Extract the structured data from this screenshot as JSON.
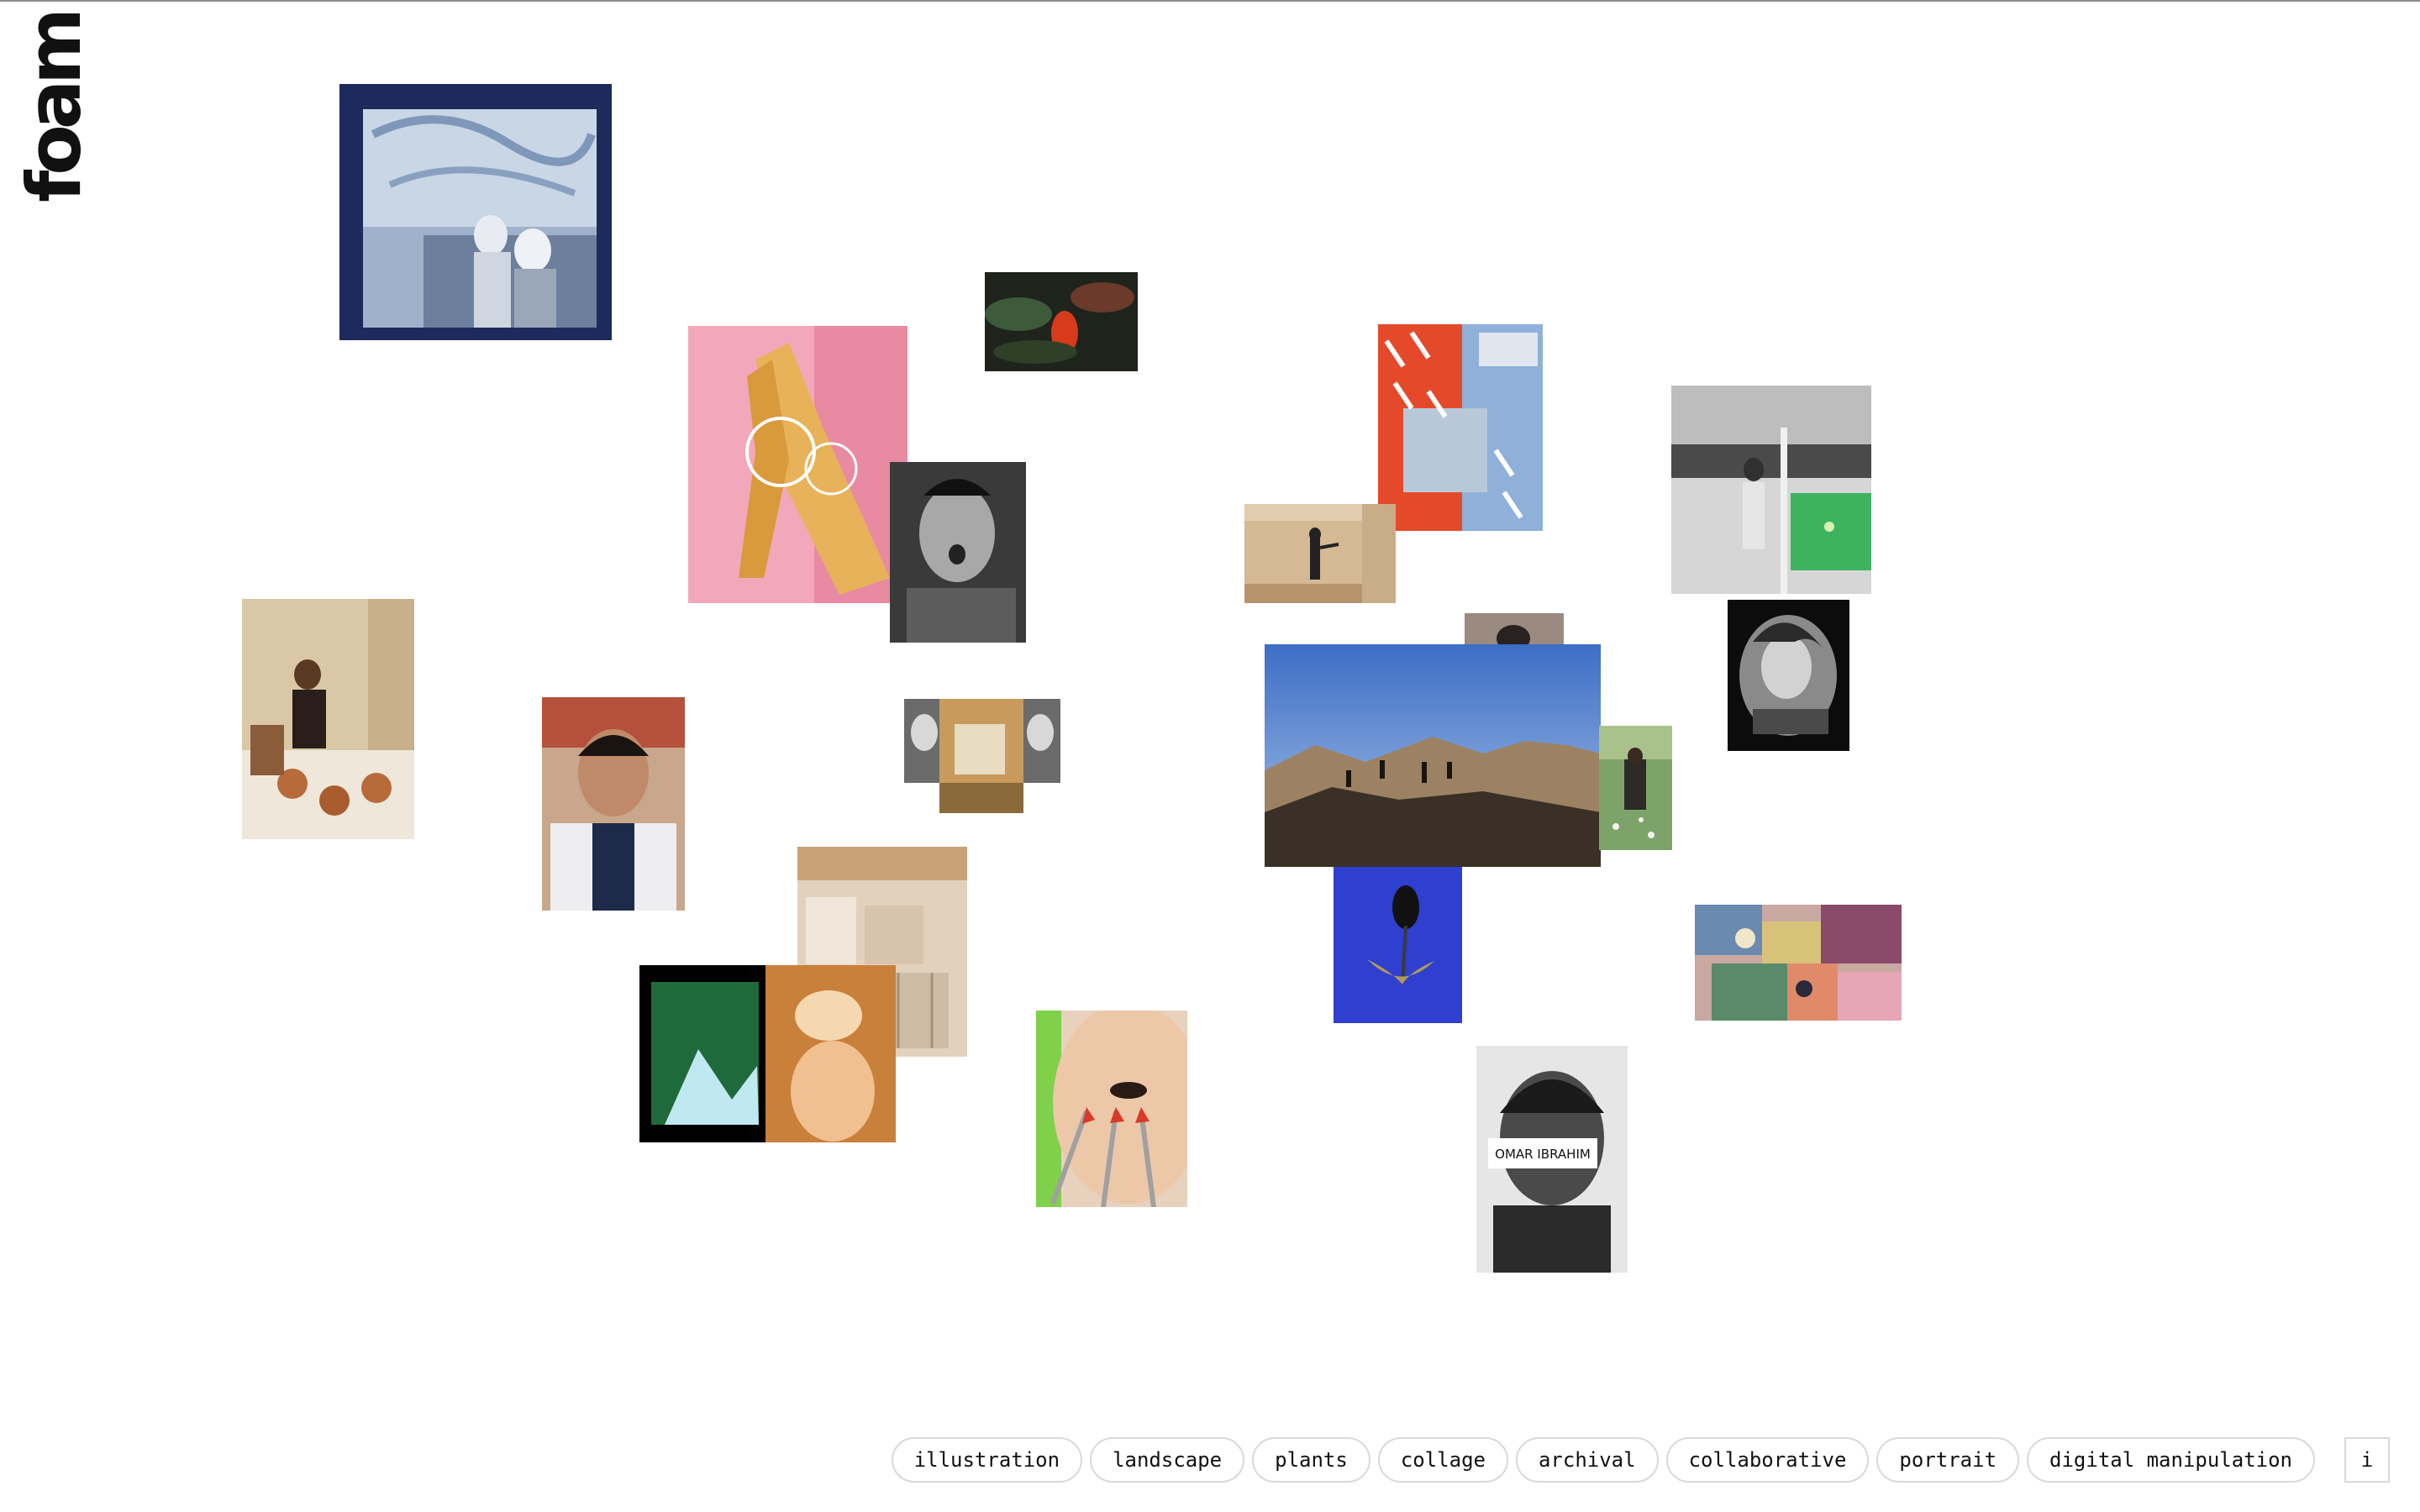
{
  "brand": {
    "logo_text": "foam"
  },
  "gallery": {
    "caption_text": "OMAR IBRAHIM"
  },
  "tags": [
    "illustration",
    "landscape",
    "plants",
    "collage",
    "archival",
    "collaborative",
    "portrait",
    "digital manipulation"
  ],
  "info_button": {
    "label": "i"
  }
}
